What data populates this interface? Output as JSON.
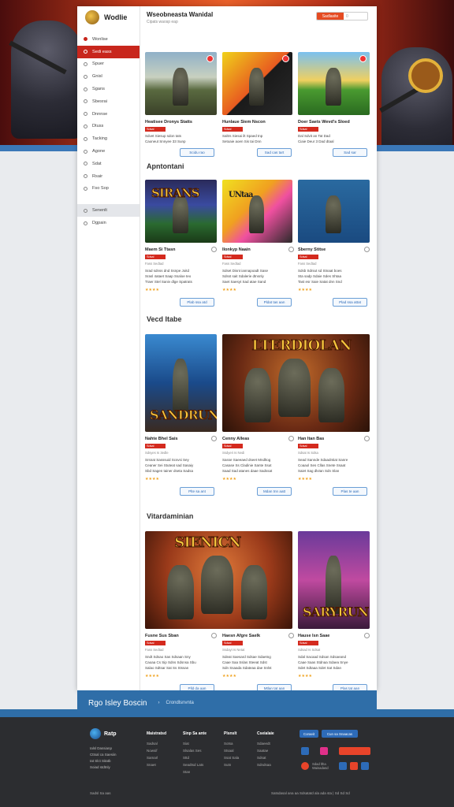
{
  "app": {
    "name": "Wodlie",
    "title": "Wseobneasta Wanidal",
    "subtitle": "Cipats waosp eap"
  },
  "search": {
    "button": "Sadlasite",
    "value": "0"
  },
  "sidebar": {
    "items": [
      {
        "label": "Wonlise",
        "state": "hot"
      },
      {
        "label": "Sedi eass",
        "state": "on"
      },
      {
        "label": "Spuer"
      },
      {
        "label": "Gnisl"
      },
      {
        "label": "Sgans"
      },
      {
        "label": "Sbesrai"
      },
      {
        "label": "Dnnnse"
      },
      {
        "label": "Dtuss"
      },
      {
        "label": "Tacking"
      },
      {
        "label": "Agone"
      },
      {
        "label": "Sdat"
      },
      {
        "label": "Rsair"
      },
      {
        "label": "Fso Sop"
      },
      {
        "label": "Senenlt",
        "state": "sel"
      },
      {
        "label": "Dgpain"
      }
    ]
  },
  "sections": [
    {
      "title": ""
    },
    {
      "title": "Apntontani"
    },
    {
      "title": "Vecd Itabe"
    },
    {
      "title": "Vitardaminian"
    }
  ],
  "cards": [
    {
      "title": "Heatisee Dronys Statts",
      "badge": "Sdsal",
      "meta": "",
      "desc": "Sdvet Siesup sdon tats\nCaoneut Snnyee 33 Sunp",
      "stars": "",
      "button": "Scidu rao"
    },
    {
      "title": "Hunlaue Siem Nscon",
      "badge": "Sdsal",
      "meta": "",
      "desc": "Saltrs Siesai ilt Spaed tnp\nSetoaie aoen Sis tai Dnn",
      "stars": "",
      "button": "Sad cas tart"
    },
    {
      "title": "Doer Saets Wevd's Sloed",
      "badge": "Sdsal",
      "meta": "",
      "desc": "Dal Sdvit an Tat Dad\nCiaie Deur 3 Dad dtaal",
      "stars": "",
      "button": "Sad sar"
    },
    {
      "title": "Maem Si Ttasn",
      "badge": "Sdsal",
      "meta": "Fass Sedtad",
      "desc": "Srad sdnss dnd Ssnpe Joitd\nSrasl 4ataet Saap Ssaloe teo\nTraer Stel Saniv dlge Spatrats",
      "stars": "★★★★",
      "button": "Plab ssa atd"
    },
    {
      "title": "Ilonkyp Naain",
      "badge": "Sdsal",
      "meta": "Fass Sedtad",
      "desc": "Sdset Disnt iannapoadt Sase\nSdsst sait Sdalerie dtnsnly\nSaet Saesyt Sad atae Sand",
      "stars": "★★★★",
      "button": "Pldat tas aan"
    },
    {
      "title": "Sberny Stitse",
      "badge": "Sdsal",
      "meta": "Fass Sedtad",
      "desc": "Sdsb Sdniut sd Stnaat boes\nSta sadp Sdaie Sdes Shtaa\nTast esr Saie Satat dnn Snd",
      "stars": "★★★★",
      "button": "Plad ssa attat"
    },
    {
      "title": "Nahte Bhel Sais",
      "badge": "Sdsal",
      "meta": "Sdsyes Is 3edle",
      "desc": "Srsnat Sasssuid Scsvsi Sey\nCeaner Sei Stuteat sad Sasaiy\nSbd Sagen tainer dseta Sadsa",
      "stars": "★★★★",
      "button": "Plte sa ant"
    },
    {
      "title": "Cenny Alleas",
      "badge": "Sdsal",
      "meta": "Ssdyeri Is Nedi",
      "desc": "Sasse Saeeaed dseet Mndltog\nCasase Ss Cladinie Sante Ssut\nSaad Sad atanes daae Sadssat",
      "stars": "★★★★",
      "button": "Mdan tnn aatt"
    },
    {
      "title": "Han Itan Bas",
      "badge": "Sdsal",
      "meta": "Sdsat Is Sdsa",
      "desc": "Sead Sannde Sdaadntiat Sanre\nCoaaol Ses Cllas Snete Ssaat\nSaiet Sag dlvtan Sdn Slan",
      "stars": "★★★★",
      "button": "Plas te aan"
    },
    {
      "title": "Fusne Sus Sban",
      "badge": "Sdsal",
      "meta": "Fass Sedtad",
      "desc": "Sndt Sdsao Sas Sdsaan Sny\nCaoaa Cs Sip Sdns Sdsnsa Sbu\nSalao Sdtsar Sat Ss Stssan",
      "stars": "★★★★",
      "button": "Plld da aan"
    },
    {
      "title": "Haesn Afgre Saelk",
      "badge": "Sdsal",
      "meta": "Ssdayt Is Netat",
      "desc": "Sdeat Saesard Sdsae Sdaetng\nCaae Saa Sslas Steeat Sdst\nSdn Ssaada Sdateaa dae Snlst",
      "stars": "★★★★",
      "button": "Mtlan tat aan"
    },
    {
      "title": "Hause Isn Saae",
      "badge": "Sdsal",
      "meta": "Sdsad Is Sdsat",
      "desc": "Sdal Sacaad Sdsan Sdsaeand\nCaae Saas Stdnaa Sdaea Snye\nSdet Sdtaaa Sdet Sat Sdan",
      "stars": "★★★★",
      "button": "Plas tat aan"
    }
  ],
  "thumb_text": [
    "SIRANS",
    "UNtaa",
    "SANDRUN",
    "LTERDIOLAN",
    "SIENICN",
    "SARYRUN"
  ],
  "blue_bar": {
    "title": "Rgo Isley Boscin",
    "link": "Crondlsnvnta"
  },
  "footer": {
    "brand": "Ratp",
    "brand_desc": [
      "Ialsl Dassianp",
      "Cttsal ca Saesiin",
      "Iat Slct Sitatb",
      "Soiad stdtnly"
    ],
    "columns": [
      {
        "title": "Maistratsd",
        "items": [
          "Sadsal",
          "Nowsif",
          "Samarl",
          "Snaet"
        ]
      },
      {
        "title": "Sinp Sa ante",
        "items": [
          "Siat",
          "Slsalas Ses",
          "Sttd",
          "Seadtsd Lats",
          "Stan"
        ]
      },
      {
        "title": "Plsnslt",
        "items": [
          "Sotsa",
          "Stsaal",
          "Ssat Sala",
          "Sutn"
        ]
      },
      {
        "title": "Cseialaie",
        "items": [
          "Sdaeedt",
          "Saatae",
          "Sdsat",
          "Sdndsaa"
        ]
      }
    ],
    "buttons": [
      "Coraeit",
      "Cun sa Snaacas"
    ],
    "social_label": "Sdad ltha\nWaisadasd",
    "copyright": "Sadsl Sa aas",
    "legal": "Satsdasal ana aa Sdsatatd ala ada sta  |  Sd  Sd  Sd"
  },
  "colors": {
    "accent": "#c8261c",
    "blue": "#2f6ea8",
    "link": "#2d6bb8",
    "star": "#f0a21e",
    "footer": "#2c2d30"
  }
}
